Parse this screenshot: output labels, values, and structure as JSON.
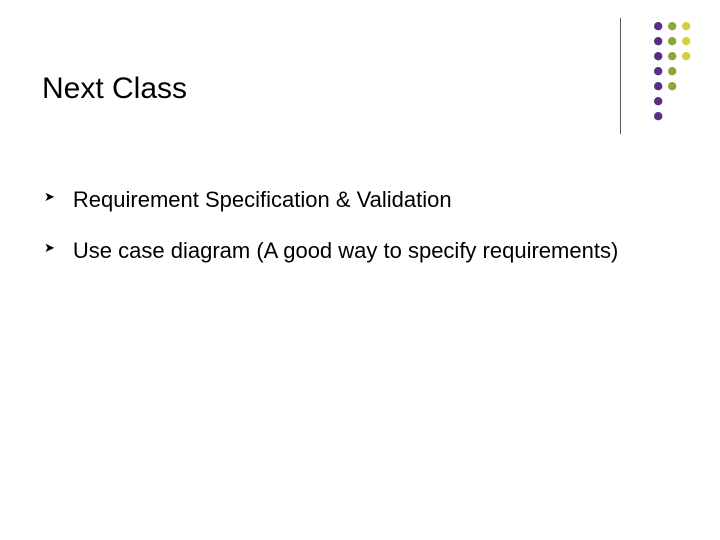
{
  "title": "Next Class",
  "bullets": [
    {
      "marker": "➤",
      "text": "Requirement Specification & Validation"
    },
    {
      "marker": "➤",
      "text": "Use case diagram (A good way to specify requirements)"
    }
  ],
  "ornament": {
    "columns": [
      {
        "color": "#5b2e86",
        "count": 7
      },
      {
        "color": "#8da63a",
        "count": 5
      },
      {
        "color": "#d8cf3c",
        "count": 3
      }
    ],
    "dot_r": 4.2,
    "col_gap": 14,
    "row_gap": 15
  }
}
